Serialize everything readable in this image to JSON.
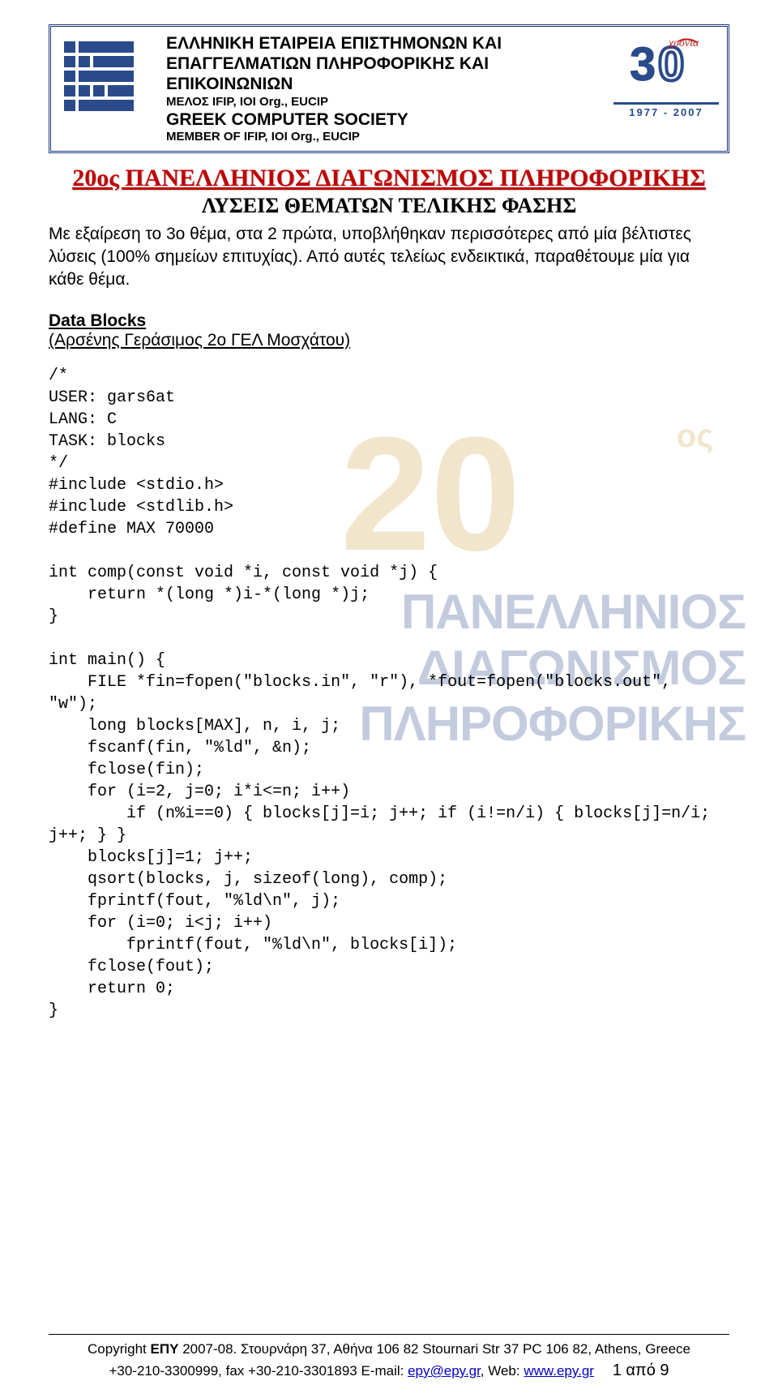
{
  "header": {
    "gr_line1": "ΕΛΛΗΝΙΚΗ ΕΤΑΙΡΕΙΑ ΕΠΙΣΤΗΜΟΝΩΝ ΚΑΙ",
    "gr_line2": "ΕΠΑΓΓΕΛΜΑΤΙΩΝ ΠΛΗΡΟΦΟΡΙΚΗΣ ΚΑΙ",
    "gr_line3": "ΕΠΙΚΟΙΝΩΝΙΩΝ",
    "member_gr": "ΜΕΛΟΣ IFIP, IOI Org., EUCIP",
    "en_line": "GREEK COMPUTER SOCIETY",
    "member_en": "MEMBER OF IFIP, IOI Org., EUCIP",
    "years": "1977 - 2007",
    "anniversary_tag": "χρόνια"
  },
  "title": "20ος ΠΑΝΕΛΛΗΝΙΟΣ ΔΙΑΓΩΝΙΣΜΟΣ ΠΛΗΡΟΦΟΡΙΚΗΣ",
  "subtitle": "ΛΥΣΕΙΣ ΘΕΜΑΤΩΝ ΤΕΛΙΚΗΣ ΦΑΣΗΣ",
  "intro": "Με εξαίρεση το 3ο θέμα, στα 2 πρώτα, υποβλήθηκαν περισσότερες από μία βέλτιστες λύσεις (100% σημείων επιτυχίας). Από αυτές τελείως ενδεικτικά, παραθέτουμε μία για κάθε θέμα.",
  "section": {
    "title": "Data Blocks",
    "author": "(Αρσένης Γεράσιμος 2ο ΓΕΛ Μοσχάτου)"
  },
  "code_block": "/*\nUSER: gars6at\nLANG: C\nTASK: blocks\n*/\n#include <stdio.h>\n#include <stdlib.h>\n#define MAX 70000\n\nint comp(const void *i, const void *j) {\n    return *(long *)i-*(long *)j;\n}\n\nint main() {\n    FILE *fin=fopen(\"blocks.in\", \"r\"), *fout=fopen(\"blocks.out\", \"w\");\n    long blocks[MAX], n, i, j;\n    fscanf(fin, \"%ld\", &n);\n    fclose(fin);\n    for (i=2, j=0; i*i<=n; i++)\n        if (n%i==0) { blocks[j]=i; j++; if (i!=n/i) { blocks[j]=n/i;\nj++; } }\n    blocks[j]=1; j++;\n    qsort(blocks, j, sizeof(long), comp);\n    fprintf(fout, \"%ld\\n\", j);\n    for (i=0; i<j; i++)\n        fprintf(fout, \"%ld\\n\", blocks[i]);\n    fclose(fout);\n    return 0;\n}",
  "watermark": {
    "big": "20",
    "os": "ος",
    "line1": "ΠΑΝΕΛΛΗΝΙΟΣ",
    "line2": "ΔΙΑΓΩΝΙΣΜΟΣ",
    "line3": "ΠΛΗΡΟΦΟΡΙΚΗΣ"
  },
  "footer": {
    "copyright_prefix": "Copyright ",
    "org": "ΕΠΥ",
    "years": " 2007-08. ",
    "address": "Στουρνάρη 37, Αθήνα 106 82 Stournari Str 37 PC 106 82, Athens, Greece",
    "phone": "+30-210-3300999, fax +30-210-3301893 ",
    "email_label": "E-mail: ",
    "email": "epy@epy.gr",
    "web_label": ", Web: ",
    "web": "www.epy.gr",
    "page": "1 από 9"
  }
}
